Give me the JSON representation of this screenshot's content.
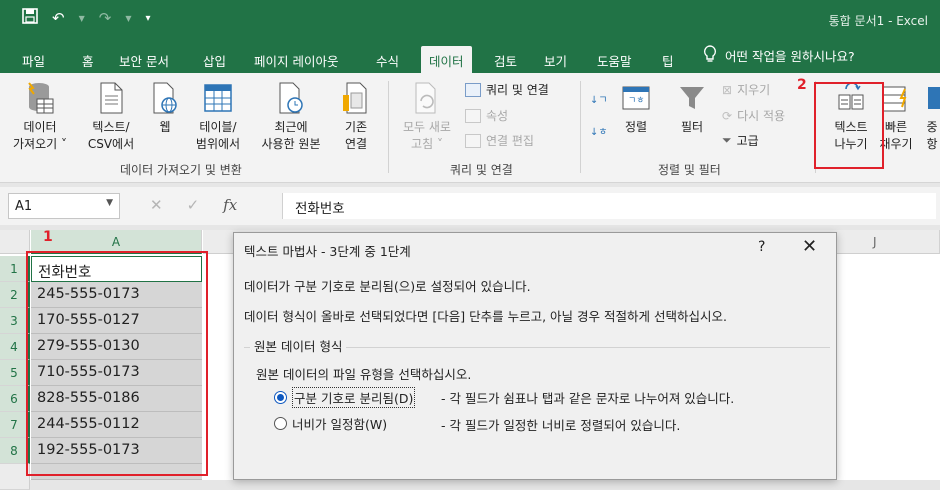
{
  "titlebar": {
    "title": "통합 문서1  -  Excel",
    "save_icon": "save-icon",
    "undo_icon": "undo-icon",
    "redo_icon": "redo-icon"
  },
  "tabs": [
    "파일",
    "홈",
    "보안 문서",
    "삽입",
    "페이지 레이아웃",
    "수식",
    "데이터",
    "검토",
    "보기",
    "도움말",
    "팁"
  ],
  "active_tab": "데이터",
  "tell_me": "어떤 작업을 원하시나요?",
  "ribbon": {
    "get_data": "데이터\n가져오기 ˅",
    "text_csv": "텍스트/\nCSV에서",
    "web": "웹",
    "table_range": "테이블/\n범위에서",
    "recent_sources": "최근에\n사용한 원본",
    "existing_connections": "기존\n연결",
    "group1_label": "데이터 가져오기 및 변환",
    "refresh_all": "모두 새로\n고침 ˅",
    "queries_connections": "쿼리 및 연결",
    "properties": "속성",
    "edit_links": "연결 편집",
    "group2_label": "쿼리 및 연결",
    "sort": "정렬",
    "filter": "필터",
    "clear": "지우기",
    "reapply": "다시 적용",
    "advanced": "고급",
    "group3_label": "정렬 및 필터",
    "text_to_columns": "텍스트\n나누기",
    "flash_fill": "빠른\n채우기",
    "remove_dup": "중\n항",
    "badge1": "1",
    "badge2": "2"
  },
  "formula_bar": {
    "name_box": "A1",
    "fx": "fx",
    "value": "전화번호"
  },
  "sheet": {
    "selected_column": "A",
    "other_column": "J",
    "rows": [
      "1",
      "2",
      "3",
      "4",
      "5",
      "6",
      "7",
      "8"
    ],
    "cells": [
      "전화번호",
      "245-555-0173",
      "170-555-0127",
      "279-555-0130",
      "710-555-0173",
      "828-555-0186",
      "244-555-0112",
      "192-555-0173"
    ]
  },
  "dialog": {
    "title": "텍스트 마법사 - 3단계 중 1단계",
    "help": "?",
    "close": "✕",
    "line1": "데이터가 구분 기호로 분리됨(으)로 설정되어 있습니다.",
    "line2": "데이터 형식이 올바로 선택되었다면 [다음] 단추를 누르고, 아닐 경우 적절하게 선택하십시오.",
    "section_label": "원본 데이터 형식",
    "prompt": "원본 데이터의 파일 유형을 선택하십시오.",
    "option1_label": "구분 기호로 분리됨(D)",
    "option1_desc": "- 각 필드가 쉼표나 탭과 같은 문자로 나누어져 있습니다.",
    "option2_label": "너비가 일정함(W)",
    "option2_desc": "- 각 필드가 일정한 너비로 정렬되어 있습니다.",
    "selected_option": "option1"
  },
  "colors": {
    "excel_green": "#217346",
    "highlight_red": "#e0202a",
    "radio_blue": "#0e58c0"
  }
}
